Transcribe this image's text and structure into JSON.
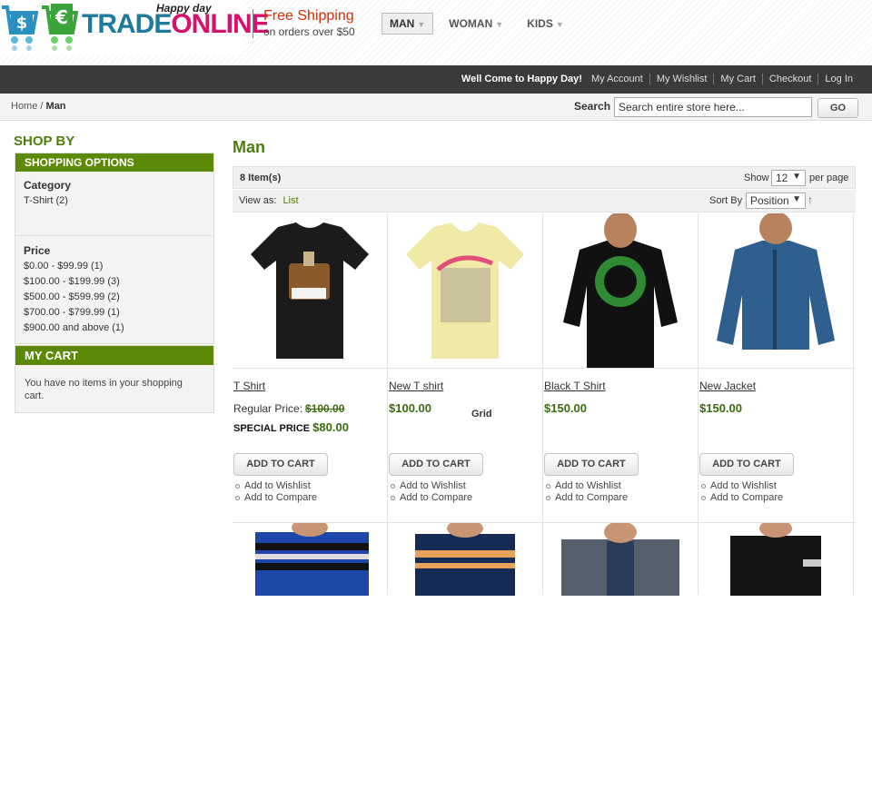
{
  "brand": {
    "name_part1": "TRADE",
    "name_part2": "ONLINE",
    "tagline": "Happy day"
  },
  "promo": {
    "title": "Free Shipping",
    "subtitle": "on orders over $50"
  },
  "top_nav": [
    {
      "label": "MAN",
      "active": true
    },
    {
      "label": "WOMAN",
      "active": false
    },
    {
      "label": "KIDS",
      "active": false
    }
  ],
  "account_bar": {
    "welcome": "Well Come to Happy Day!",
    "links": [
      "My Account",
      "My Wishlist",
      "My Cart",
      "Checkout",
      "Log In"
    ]
  },
  "breadcrumb": {
    "home": "Home",
    "separator": "/",
    "current": "Man"
  },
  "search": {
    "label": "Search",
    "placeholder": "Search entire store here...",
    "button": "GO"
  },
  "sidebar": {
    "title": "SHOP BY",
    "options_header": "SHOPPING OPTIONS",
    "category": {
      "title": "Category",
      "items": [
        "T-Shirt (2)"
      ]
    },
    "price": {
      "title": "Price",
      "items": [
        "$0.00 - $99.99 (1)",
        "$100.00 - $199.99 (3)",
        "$500.00 - $599.99 (2)",
        "$700.00 - $799.99 (1)",
        "$900.00 and above (1)"
      ]
    },
    "cart": {
      "header": "MY CART",
      "text": "You have no items in your shopping cart."
    }
  },
  "main": {
    "title": "Man",
    "toolbar": {
      "item_count": "8 Item(s)",
      "show_label": "Show",
      "show_value": "12",
      "per_page": "per page",
      "view_as_label": "View as:",
      "view_grid": "Grid",
      "view_list": "List",
      "sort_label": "Sort By",
      "sort_value": "Position",
      "sort_direction_icon": "↑"
    },
    "products": [
      {
        "name": "T Shirt",
        "regular_label": "Regular Price:",
        "regular_price": "$100.00",
        "special_label": "SPECIAL PRICE",
        "special_price": "$80.00",
        "shirt_color": "#1b1b1b"
      },
      {
        "name": "New T shirt",
        "price": "$100.00",
        "shirt_color": "#f1e9a8"
      },
      {
        "name": "Black T Shirt",
        "price": "$150.00",
        "shirt_color": "#111111"
      },
      {
        "name": "New Jacket",
        "price": "$150.00",
        "shirt_color": "#2f5f8f"
      }
    ],
    "add_to_cart": "ADD TO CART",
    "add_to_wishlist": "Add to Wishlist",
    "add_to_compare": "Add to Compare"
  },
  "colors": {
    "accent_green": "#5c8a06",
    "title_green": "#4e7d0f",
    "shipping_red": "#d62c08",
    "dark_bar": "#3a3a3a"
  }
}
